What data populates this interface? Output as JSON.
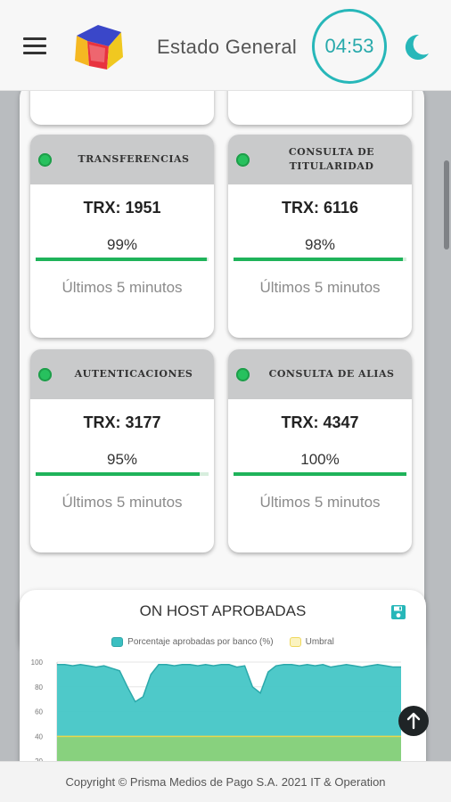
{
  "header": {
    "title": "Estado General",
    "timer": "04:53",
    "menu_icon": "hamburger-icon",
    "theme_icon": "moon-icon",
    "logo": "prisma-logo",
    "accent_color": "#27b7b9"
  },
  "cards": [
    {
      "name": "TRANSFERENCIAS",
      "trx": "TRX: 1951",
      "percent_label": "99%",
      "percent": 99,
      "period": "Últimos 5 minutos",
      "status_color": "#27c15e"
    },
    {
      "name": "CONSULTA DE TITULARIDAD",
      "trx": "TRX: 6116",
      "percent_label": "98%",
      "percent": 98,
      "period": "Últimos 5 minutos",
      "status_color": "#27c15e"
    },
    {
      "name": "AUTENTICACIONES",
      "trx": "TRX: 3177",
      "percent_label": "95%",
      "percent": 95,
      "period": "Últimos 5 minutos",
      "status_color": "#27c15e"
    },
    {
      "name": "CONSULTA DE ALIAS",
      "trx": "TRX: 4347",
      "percent_label": "100%",
      "percent": 100,
      "period": "Últimos 5 minutos",
      "status_color": "#27c15e"
    }
  ],
  "chart": {
    "title": "ON HOST APROBADAS",
    "save_icon": "save-icon",
    "legend": [
      "Porcentaje aprobadas por banco (%)",
      "Umbral"
    ],
    "y_ticks": [
      "100",
      "80",
      "60",
      "40",
      "20"
    ]
  },
  "chart_data": {
    "type": "area",
    "title": "ON HOST APROBADAS",
    "xlabel": "",
    "ylabel": "",
    "ylim": [
      0,
      100
    ],
    "grid": true,
    "legend_position": "top",
    "series": [
      {
        "name": "Porcentaje aprobadas por banco (%)",
        "color": "#3bbfc1",
        "values": [
          98,
          98,
          97,
          98,
          97,
          96,
          97,
          95,
          93,
          80,
          68,
          72,
          90,
          98,
          98,
          97,
          98,
          98,
          97,
          98,
          97,
          98,
          98,
          96,
          97,
          80,
          75,
          92,
          97,
          98,
          98,
          97,
          98,
          97,
          98,
          96,
          97,
          98,
          97,
          96,
          97,
          98,
          97,
          96,
          96
        ]
      },
      {
        "name": "Umbral",
        "color": "#8fd175",
        "values": [
          40,
          40,
          40,
          40,
          40,
          40,
          40,
          40,
          40,
          40,
          40,
          40,
          40,
          40,
          40,
          40,
          40,
          40,
          40,
          40,
          40,
          40,
          40,
          40,
          40,
          40,
          40,
          40,
          40,
          40,
          40,
          40,
          40,
          40,
          40,
          40,
          40,
          40,
          40,
          40,
          40,
          40,
          40,
          40,
          40
        ]
      }
    ]
  },
  "scroll_top_icon": "arrow-up-icon",
  "footer": {
    "text": "Copyright © Prisma Medios de Pago S.A. 2021 IT & Operation"
  }
}
